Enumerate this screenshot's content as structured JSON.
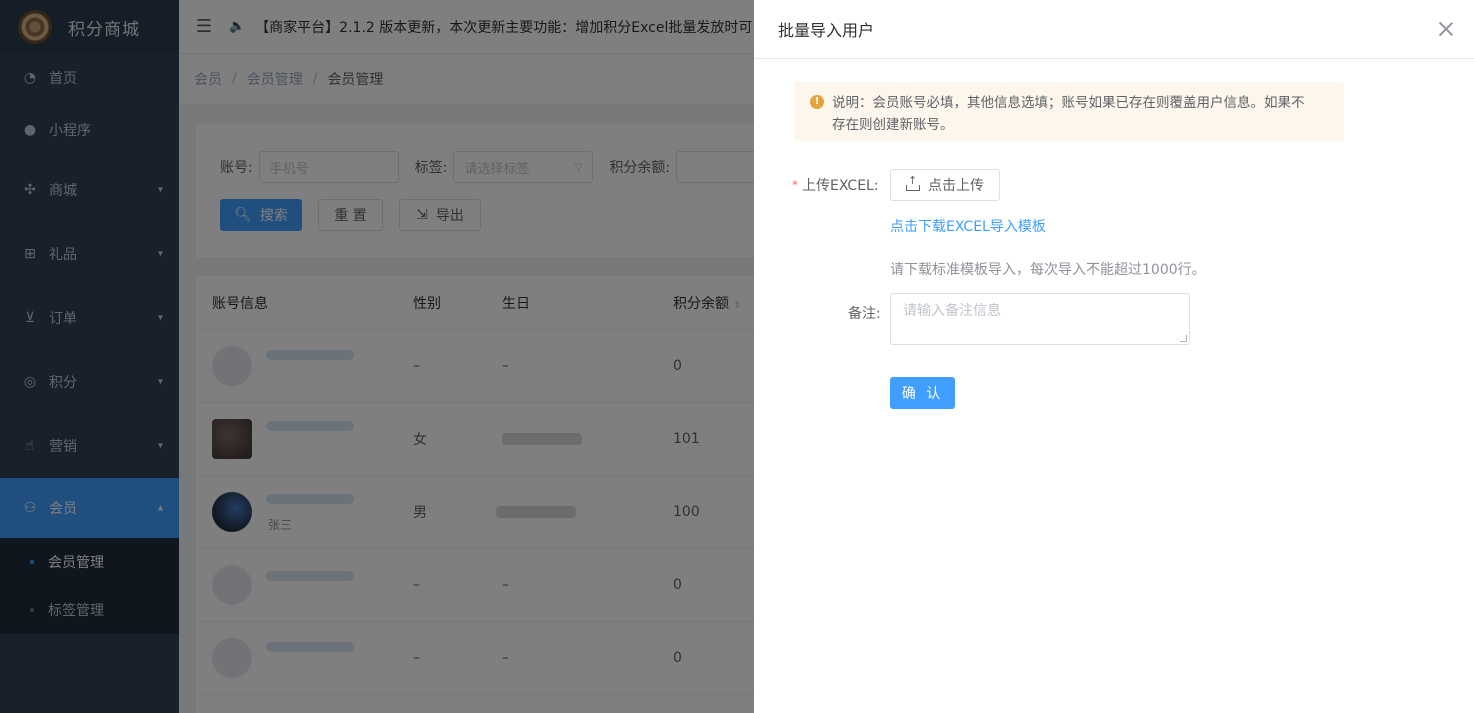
{
  "app": {
    "title": "积分商城"
  },
  "sidebar": {
    "items": [
      {
        "label": "首页",
        "icon": "dashboard-icon"
      },
      {
        "label": "小程序",
        "icon": "wechat-icon"
      },
      {
        "label": "商城",
        "icon": "shop-icon"
      },
      {
        "label": "礼品",
        "icon": "gift-icon"
      },
      {
        "label": "订单",
        "icon": "cart-icon"
      },
      {
        "label": "积分",
        "icon": "points-icon"
      },
      {
        "label": "营销",
        "icon": "thumb-up-icon"
      },
      {
        "label": "会员",
        "icon": "member-icon"
      }
    ],
    "submenu": [
      {
        "label": "会员管理"
      },
      {
        "label": "标签管理"
      }
    ]
  },
  "header": {
    "notice": "【商家平台】2.1.2 版本更新，本次更新主要功能：增加积分Excel批量发放时可"
  },
  "breadcrumb": [
    "会员",
    "会员管理",
    "会员管理"
  ],
  "search": {
    "account_label": "账号:",
    "account_placeholder": "手机号",
    "tag_label": "标签:",
    "tag_placeholder": "请选择标签",
    "points_label": "积分余额:",
    "search_button": "搜索",
    "reset_button": "重 置",
    "export_button": "导出"
  },
  "table": {
    "headers": [
      "账号信息",
      "性别",
      "生日",
      "积分余额"
    ],
    "rows": [
      {
        "name": "",
        "gender": "–",
        "birthday": "–",
        "points": "0"
      },
      {
        "name": "",
        "gender": "女",
        "birthday": "",
        "points": "101"
      },
      {
        "name": "张三",
        "gender": "男",
        "birthday": "",
        "points": "100"
      },
      {
        "name": "",
        "gender": "–",
        "birthday": "–",
        "points": "0"
      },
      {
        "name": "",
        "gender": "–",
        "birthday": "–",
        "points": "0"
      }
    ]
  },
  "drawer": {
    "title": "批量导入用户",
    "alert_line1": "说明：会员账号必填，其他信息选填；账号如果已存在则覆盖用户信息。如果不",
    "alert_line2": "存在则创建新账号。",
    "required_mark": "*",
    "upload_label": "上传EXCEL:",
    "upload_button": "点击上传",
    "download_link": "点击下载EXCEL导入模板",
    "hint": "请下载标准模板导入，每次导入不能超过1000行。",
    "remark_label": "备注:",
    "remark_placeholder": "请输入备注信息",
    "confirm_button": "确 认"
  },
  "colors": {
    "primary": "#409eff",
    "sidebar_bg": "#304156",
    "warning_bg": "#fdf6ec",
    "warning_icon": "#e6a23c"
  }
}
